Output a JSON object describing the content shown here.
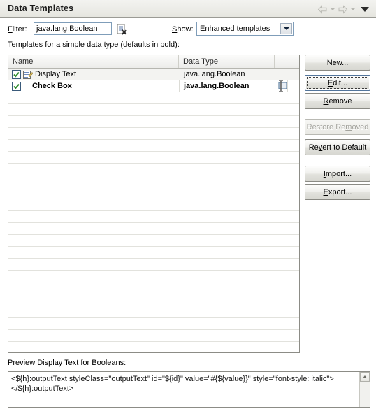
{
  "window": {
    "title": "Data Templates",
    "nav": {
      "back_icon": "arrow-left-icon",
      "back_caret_icon": "caret-down-icon",
      "forward_icon": "arrow-right-icon",
      "forward_caret_icon": "caret-down-icon",
      "menu_icon": "chevron-down-icon"
    }
  },
  "filter": {
    "label": "Filter:",
    "label_mnemonic": "F",
    "value": "java.lang.Boolean",
    "placeholder": "",
    "clear_icon": "clear-filter-icon"
  },
  "show": {
    "label": "Show:",
    "label_mnemonic": "S",
    "selected": "Enhanced templates",
    "caret_icon": "chevron-down-icon"
  },
  "table": {
    "label": "Templates for a simple data type (defaults in bold):",
    "label_mnemonic": "T",
    "columns": [
      "Name",
      "Data Type",
      "",
      ""
    ],
    "rows": [
      {
        "checked": true,
        "check_icon": "checkmark-icon",
        "icon": "template-document-icon",
        "name": "Display Text",
        "data_type": "java.lang.Boolean",
        "bold": false
      },
      {
        "checked": true,
        "check_icon": "checkmark-icon",
        "icon": "",
        "name": "Check Box",
        "data_type": "java.lang.Boolean",
        "bold": true
      }
    ],
    "empty_row_count": 23,
    "cursor_icon": "text-ibeam-cursor"
  },
  "buttons": [
    {
      "label": "New...",
      "mnemonic": "N",
      "state": "normal"
    },
    {
      "label": "Edit...",
      "mnemonic": "E",
      "state": "focused"
    },
    {
      "label": "Remove",
      "mnemonic": "R",
      "state": "normal"
    },
    {
      "label": "Restore Removed",
      "mnemonic": "m",
      "state": "disabled"
    },
    {
      "label": "Revert to Default",
      "mnemonic": "v",
      "state": "normal"
    },
    {
      "label": "Import...",
      "mnemonic": "I",
      "state": "normal"
    },
    {
      "label": "Export...",
      "mnemonic": "E",
      "state": "normal"
    }
  ],
  "preview": {
    "label": "Preview Display Text for Booleans:",
    "label_mnemonic": "w",
    "content": "<${h}:outputText styleClass=\"outputText\" id=\"${id}\" value=\"#{${value}}\" style=\"font-style: italic\">\n</$­{h}:outputText>",
    "scroll_up_icon": "scroll-up-arrow-icon"
  },
  "colors": {
    "banner": "#ebebe6",
    "accent_border": "#7f9db9",
    "check_green": "#2e8b2e",
    "text": "#000000",
    "disabled_text": "#a3a39d"
  }
}
